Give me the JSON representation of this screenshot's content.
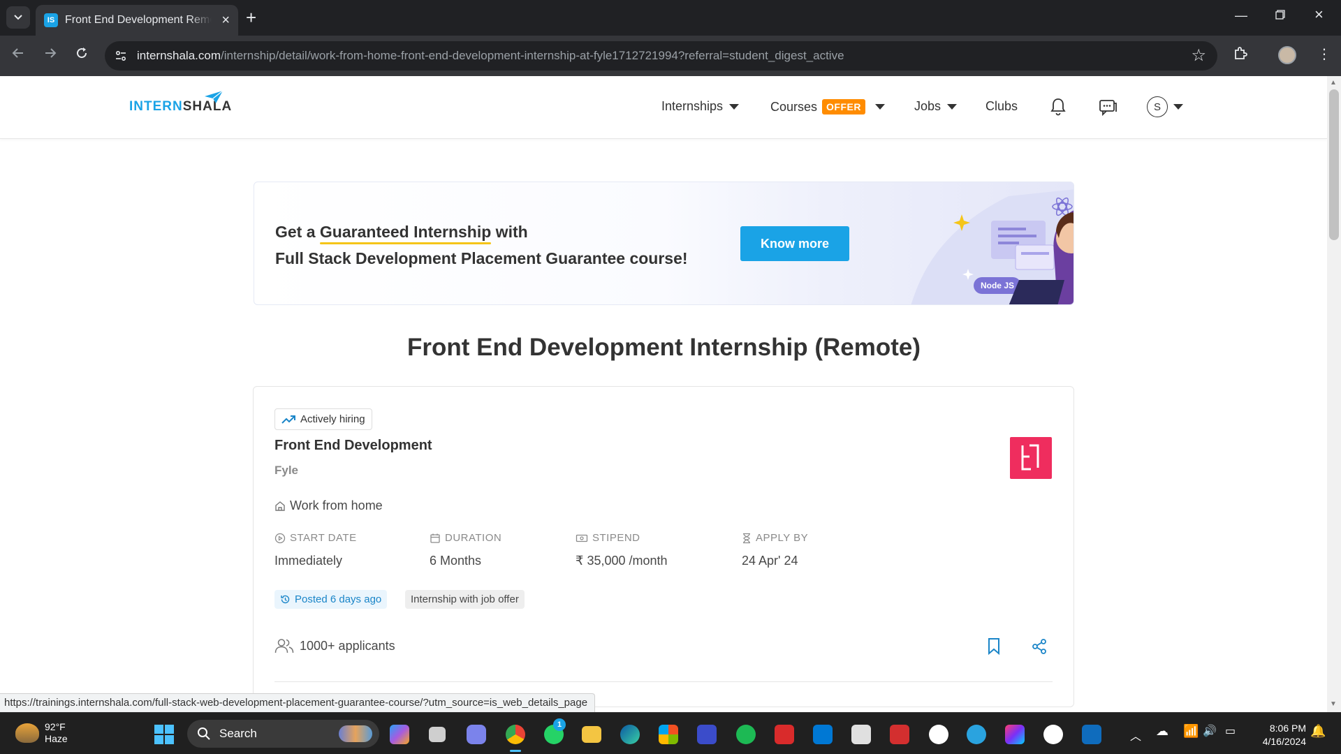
{
  "browser": {
    "tab_title": "Front End Development Remote",
    "favicon_text": "IS",
    "url_host": "internshala.com",
    "url_path": "/internship/detail/work-from-home-front-end-development-internship-at-fyle1712721994?referral=student_digest_active"
  },
  "header": {
    "logo_part1": "INTERN",
    "logo_part2": "SHALA",
    "nav": {
      "internships": "Internships",
      "courses": "Courses",
      "offer_badge": "OFFER",
      "jobs": "Jobs",
      "clubs": "Clubs"
    },
    "avatar_initial": "S"
  },
  "banner": {
    "line1_pre": "Get a ",
    "line1_highlight": "Guaranteed Internship",
    "line1_post": " with",
    "line2": "Full Stack Development Placement Guarantee course!",
    "button": "Know more",
    "tag_node": "Node JS",
    "tag_js": "JS"
  },
  "page_title": "Front End Development Internship (Remote)",
  "listing": {
    "badge": "Actively hiring",
    "title": "Front End Development",
    "company": "Fyle",
    "location": "Work from home",
    "start_date_label": "START DATE",
    "start_date": "Immediately",
    "duration_label": "DURATION",
    "duration": "6 Months",
    "stipend_label": "STIPEND",
    "stipend": "₹ 35,000 /month",
    "apply_by_label": "APPLY BY",
    "apply_by": "24 Apr' 24",
    "posted": "Posted 6 days ago",
    "job_offer_tag": "Internship with job offer",
    "applicants": "1000+ applicants"
  },
  "status_url": "https://trainings.internshala.com/full-stack-web-development-placement-guarantee-course/?utm_source=is_web_details_page",
  "taskbar": {
    "weather_temp": "92°F",
    "weather_desc": "Haze",
    "search": "Search",
    "whatsapp_badge": "1",
    "time": "8:06 PM",
    "date": "4/16/2024"
  },
  "colors": {
    "brand_blue": "#1aa3e6",
    "offer_orange": "#ff8c00",
    "company_logo": "#ef2d5e"
  }
}
